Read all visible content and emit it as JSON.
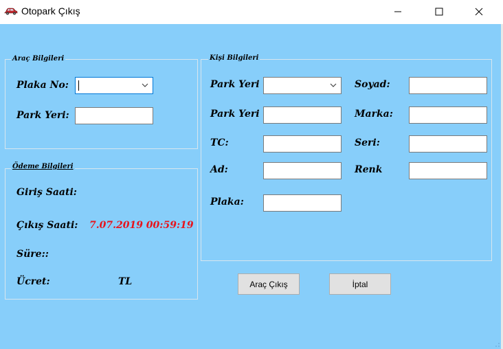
{
  "window": {
    "title": "Otopark Çıkış",
    "brand_color": "#87CEFA"
  },
  "vehicle_group": {
    "title": "Araç Bilgileri",
    "plate_label": "Plaka No:",
    "plate_value": "",
    "park_label": "Park Yeri:",
    "park_value": ""
  },
  "payment_group": {
    "title": "Ödeme Bilgileri",
    "entry_label": "Giriş Saati:",
    "entry_value": "",
    "exit_label": "Çıkış Saati:",
    "exit_value": "7.07.2019 00:59:19",
    "duration_label": "Süre::",
    "fee_label": "Ücret:",
    "currency": "TL"
  },
  "person_group": {
    "title": "Kişi Bilgileri",
    "park_label_1": "Park Yeri",
    "park_label_2": "Park Yeri",
    "tc_label": "TC:",
    "name_label": "Ad:",
    "plate_label": "Plaka:",
    "surname_label": "Soyad:",
    "brand_label": "Marka:",
    "series_label": "Seri:",
    "color_label": "Renk"
  },
  "buttons": {
    "exit_label": "Araç Çıkış",
    "cancel_label": "İptal"
  }
}
